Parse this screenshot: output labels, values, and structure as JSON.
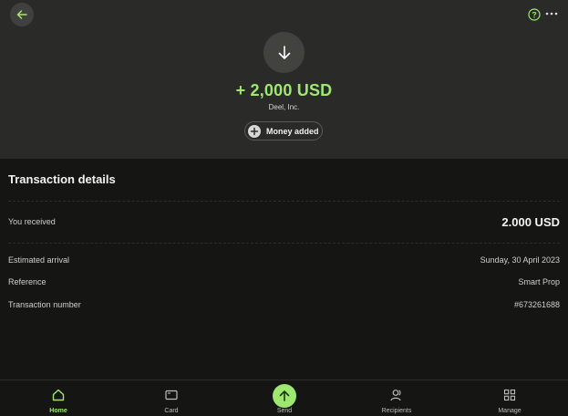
{
  "header": {
    "back_icon": "arrow-left-icon",
    "help_icon": "question-circle-icon",
    "more_icon": "more-horizontal-icon",
    "direction_icon": "arrow-down-icon",
    "amount": "+ 2,000 USD",
    "sender": "Deel, Inc.",
    "status_icon": "plus-circle-icon",
    "status_label": "Money added"
  },
  "details": {
    "title": "Transaction details",
    "received_label": "You received",
    "received_value": "2.000 USD",
    "rows": [
      {
        "label": "Estimated arrival",
        "value": "Sunday, 30 April 2023"
      },
      {
        "label": "Reference",
        "value": "Smart Prop"
      },
      {
        "label": "Transaction number",
        "value": "#673261688"
      }
    ]
  },
  "tabbar": {
    "active": "Home",
    "tabs": [
      {
        "label": "Home",
        "icon": "home-icon"
      },
      {
        "label": "Card",
        "icon": "card-icon"
      },
      {
        "label": "Send",
        "icon": "arrow-up-icon"
      },
      {
        "label": "Recipients",
        "icon": "recipients-icon"
      },
      {
        "label": "Manage",
        "icon": "grid-icon"
      }
    ]
  },
  "colors": {
    "accent": "#9fe870",
    "hero_bg": "#2a2b29",
    "page_bg": "#151614"
  }
}
